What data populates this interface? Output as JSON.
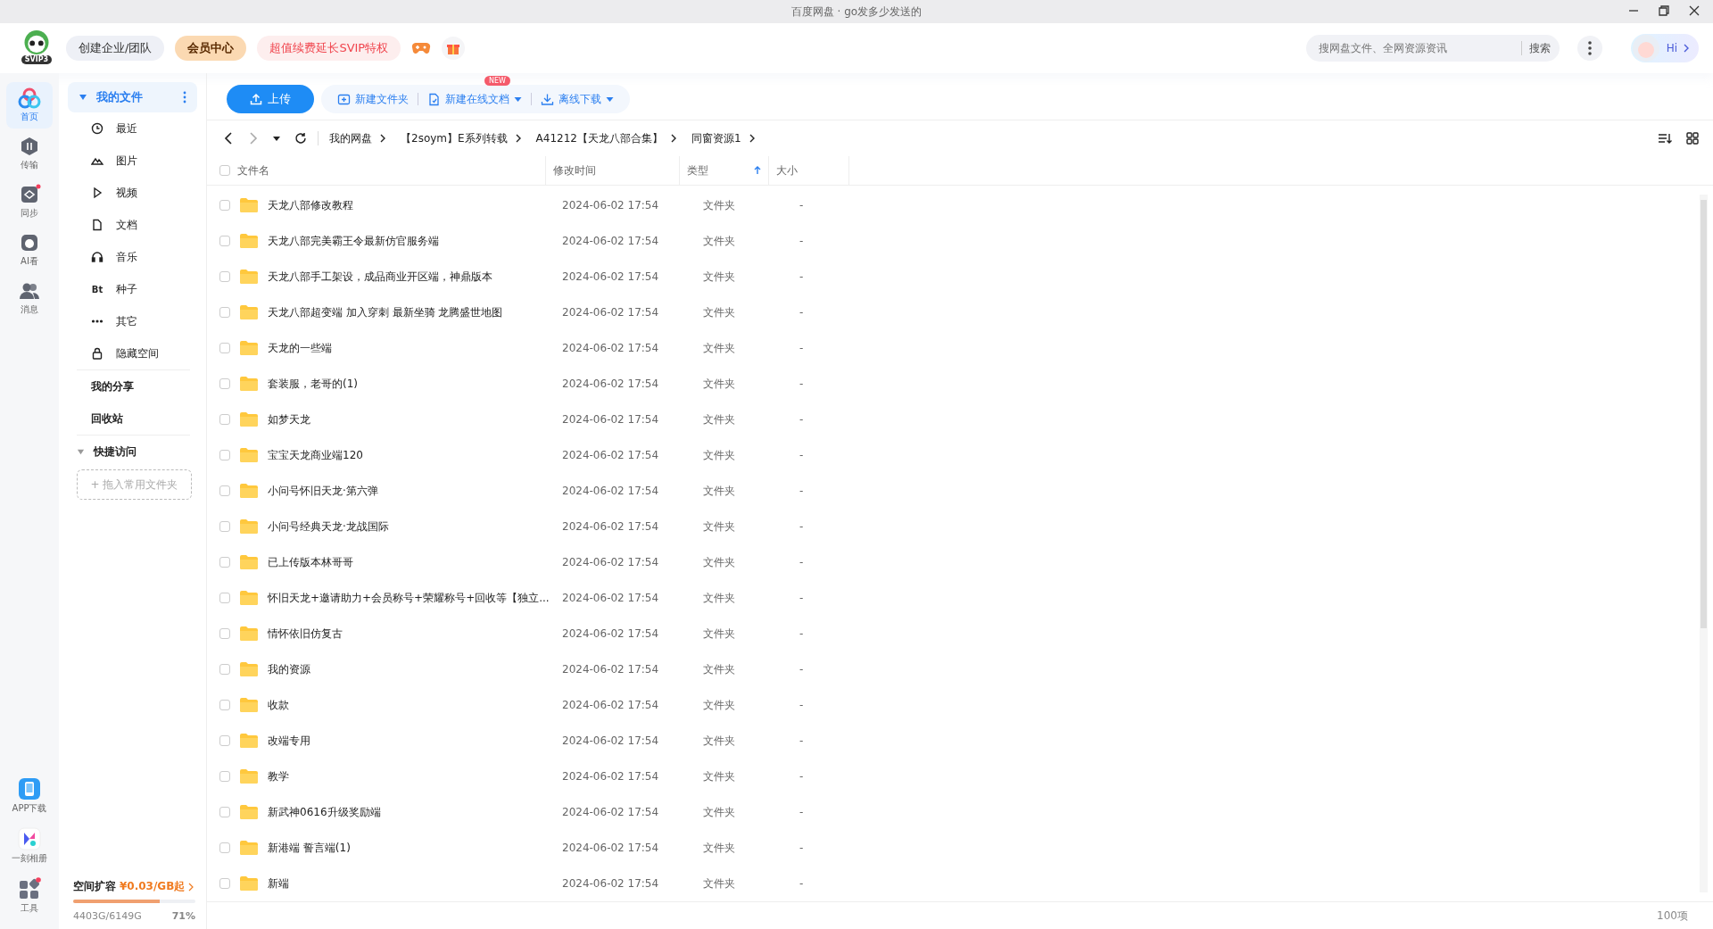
{
  "window": {
    "title": "百度网盘 · go发多少发送的"
  },
  "header": {
    "logo_badge": "SVIP3",
    "buttons": [
      {
        "label": "创建企业/团队",
        "kind": "plain"
      },
      {
        "label": "会员中心",
        "kind": "vip"
      },
      {
        "label": "超值续费延长SVIP特权",
        "kind": "promo"
      }
    ],
    "search": {
      "placeholder": "搜网盘文件、全网资源资讯",
      "button": "搜索"
    },
    "greeting": "Hi"
  },
  "rail": {
    "items": [
      {
        "label": "首页",
        "kind": "home",
        "selected": true,
        "dot": false
      },
      {
        "label": "传输",
        "kind": "transfer",
        "selected": false,
        "dot": false
      },
      {
        "label": "同步",
        "kind": "sync",
        "selected": false,
        "dot": true
      },
      {
        "label": "AI看",
        "kind": "ai",
        "selected": false,
        "dot": false
      },
      {
        "label": "消息",
        "kind": "people",
        "selected": false,
        "dot": false
      }
    ],
    "bottom": [
      {
        "label": "APP下载",
        "kind": "phone",
        "dot": false
      },
      {
        "label": "一刻相册",
        "kind": "album",
        "dot": false
      },
      {
        "label": "工具",
        "kind": "tools",
        "dot": true
      }
    ]
  },
  "sidebar": {
    "my_files": {
      "label": "我的文件",
      "expanded": true,
      "selected": true
    },
    "items": [
      {
        "label": "最近",
        "kind": "clock"
      },
      {
        "label": "图片",
        "kind": "mountain"
      },
      {
        "label": "视频",
        "kind": "play"
      },
      {
        "label": "文档",
        "kind": "doc"
      },
      {
        "label": "音乐",
        "kind": "headphones"
      },
      {
        "label": "种子",
        "kind": "bt",
        "icon_text": "Bt"
      },
      {
        "label": "其它",
        "kind": "dots"
      },
      {
        "label": "隐藏空间",
        "kind": "lock"
      }
    ],
    "links": [
      "我的分享",
      "回收站"
    ],
    "quick_access": {
      "label": "快捷访问",
      "expanded": true,
      "drop_hint": "+ 拖入常用文件夹"
    },
    "storage": {
      "label": "空间扩容",
      "price": "¥0.03/GB起",
      "used": "4403G/6149G",
      "percent": "71%",
      "level": 0.71
    }
  },
  "toolbar": {
    "upload": "上传",
    "actions": [
      {
        "label": "新建文件夹",
        "kind": "folder",
        "dropdown": false
      },
      {
        "label": "新建在线文档",
        "kind": "doc",
        "dropdown": true,
        "badge": "NEW"
      },
      {
        "label": "离线下载",
        "kind": "download",
        "dropdown": true
      }
    ]
  },
  "breadcrumb": [
    "我的网盘",
    "【2soym】E系列转载",
    "A41212【天龙八部合集】",
    "同窗资源1"
  ],
  "table": {
    "select_all_checked": false,
    "columns": [
      {
        "label": "文件名",
        "sorted": false
      },
      {
        "label": "修改时间",
        "sorted": false
      },
      {
        "label": "类型",
        "sorted": true
      },
      {
        "label": "大小",
        "sorted": false
      }
    ],
    "rows": [
      {
        "name": "天龙八部修改教程",
        "modified": "2024-06-02 17:54",
        "type": "文件夹",
        "size": "-",
        "checked": false
      },
      {
        "name": "天龙八部完美霸王令最新仿官服务端",
        "modified": "2024-06-02 17:54",
        "type": "文件夹",
        "size": "-",
        "checked": false
      },
      {
        "name": "天龙八部手工架设，成品商业开区端，神鼎版本",
        "modified": "2024-06-02 17:54",
        "type": "文件夹",
        "size": "-",
        "checked": false
      },
      {
        "name": "天龙八部超变端 加入穿刺 最新坐骑 龙腾盛世地图",
        "modified": "2024-06-02 17:54",
        "type": "文件夹",
        "size": "-",
        "checked": false
      },
      {
        "name": "天龙的一些端",
        "modified": "2024-06-02 17:54",
        "type": "文件夹",
        "size": "-",
        "checked": false
      },
      {
        "name": "套装服，老哥的(1)",
        "modified": "2024-06-02 17:54",
        "type": "文件夹",
        "size": "-",
        "checked": false
      },
      {
        "name": "如梦天龙",
        "modified": "2024-06-02 17:54",
        "type": "文件夹",
        "size": "-",
        "checked": false
      },
      {
        "name": "宝宝天龙商业端120",
        "modified": "2024-06-02 17:54",
        "type": "文件夹",
        "size": "-",
        "checked": false
      },
      {
        "name": "小问号怀旧天龙·第六弹",
        "modified": "2024-06-02 17:54",
        "type": "文件夹",
        "size": "-",
        "checked": false
      },
      {
        "name": "小问号经典天龙·龙战国际",
        "modified": "2024-06-02 17:54",
        "type": "文件夹",
        "size": "-",
        "checked": false
      },
      {
        "name": "已上传版本林哥哥",
        "modified": "2024-06-02 17:54",
        "type": "文件夹",
        "size": "-",
        "checked": false
      },
      {
        "name": "怀旧天龙+邀请助力+会员称号+荣耀称号+回收等【独立...",
        "modified": "2024-06-02 17:54",
        "type": "文件夹",
        "size": "-",
        "checked": false
      },
      {
        "name": "情怀依旧仿复古",
        "modified": "2024-06-02 17:54",
        "type": "文件夹",
        "size": "-",
        "checked": false
      },
      {
        "name": "我的资源",
        "modified": "2024-06-02 17:54",
        "type": "文件夹",
        "size": "-",
        "checked": false
      },
      {
        "name": "收款",
        "modified": "2024-06-02 17:54",
        "type": "文件夹",
        "size": "-",
        "checked": false
      },
      {
        "name": "改端专用",
        "modified": "2024-06-02 17:54",
        "type": "文件夹",
        "size": "-",
        "checked": false
      },
      {
        "name": "教学",
        "modified": "2024-06-02 17:54",
        "type": "文件夹",
        "size": "-",
        "checked": false
      },
      {
        "name": "新武神0616升级奖励端",
        "modified": "2024-06-02 17:54",
        "type": "文件夹",
        "size": "-",
        "checked": false
      },
      {
        "name": "新港端  誓言端(1)",
        "modified": "2024-06-02 17:54",
        "type": "文件夹",
        "size": "-",
        "checked": false
      },
      {
        "name": "新端",
        "modified": "2024-06-02 17:54",
        "type": "文件夹",
        "size": "-",
        "checked": false
      }
    ]
  },
  "status_bar": {
    "count": "100项"
  }
}
